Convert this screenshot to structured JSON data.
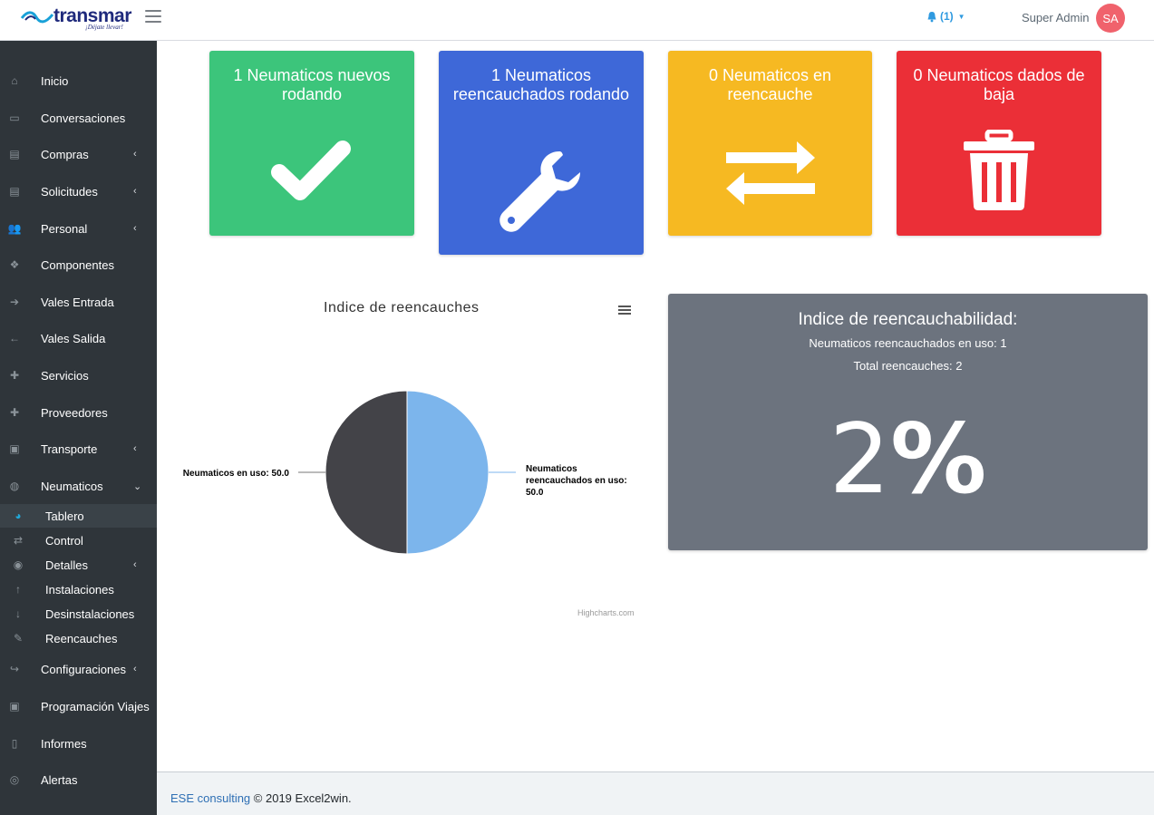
{
  "header": {
    "logo_text": "transmar",
    "logo_tagline": "¡Déjate llevar!",
    "notification_count": "(1)",
    "user_name": "Super Admin",
    "user_initials": "SA"
  },
  "sidebar": {
    "items": [
      {
        "label": "Inicio",
        "icon": "home-icon"
      },
      {
        "label": "Conversaciones",
        "icon": "chat-icon"
      },
      {
        "label": "Compras",
        "icon": "card-icon"
      },
      {
        "label": "Solicitudes",
        "icon": "card-icon"
      },
      {
        "label": "Personal",
        "icon": "users-icon"
      },
      {
        "label": "Componentes",
        "icon": "cubes-icon"
      },
      {
        "label": "Vales Entrada",
        "icon": "arrow-right-icon"
      },
      {
        "label": "Vales Salida",
        "icon": "arrow-left-icon"
      },
      {
        "label": "Servicios",
        "icon": "plus-icon"
      },
      {
        "label": "Proveedores",
        "icon": "plus-icon"
      },
      {
        "label": "Transporte",
        "icon": "bus-icon"
      },
      {
        "label": "Neumaticos",
        "icon": "globe-icon"
      }
    ],
    "sub_items": [
      {
        "label": "Tablero",
        "icon": "pie-icon"
      },
      {
        "label": "Control",
        "icon": "exchange-icon"
      },
      {
        "label": "Detalles",
        "icon": "eye-icon"
      },
      {
        "label": "Instalaciones",
        "icon": "arrow-up-icon"
      },
      {
        "label": "Desinstalaciones",
        "icon": "arrow-down-icon"
      },
      {
        "label": "Reencauches",
        "icon": "wrench-icon"
      }
    ],
    "items_bottom": [
      {
        "label": "Configuraciones",
        "icon": "share-icon"
      },
      {
        "label": "Programación Viajes",
        "icon": "bus-icon"
      },
      {
        "label": "Informes",
        "icon": "file-icon"
      },
      {
        "label": "Alertas",
        "icon": "alert-icon"
      }
    ]
  },
  "cards": [
    {
      "title": "1 Neumaticos nuevos rodando",
      "icon": "check-icon",
      "color": "#3cc57b"
    },
    {
      "title": "1 Neumaticos reencauchados rodando",
      "icon": "wrench-icon",
      "color": "#3e68d8"
    },
    {
      "title": "0 Neumaticos en reencauche",
      "icon": "exchange-icon",
      "color": "#f6b922"
    },
    {
      "title": "0 Neumaticos dados de baja",
      "icon": "trash-icon",
      "color": "#eb2f37"
    }
  ],
  "chart_data": {
    "type": "pie",
    "title": "Indice de reencauches",
    "series": [
      {
        "name": "Neumaticos reencauchados en uso",
        "value": 50.0,
        "label": "Neumaticos reencauchados en uso: 50.0",
        "color": "#7cb5ec"
      },
      {
        "name": "Neumaticos en uso",
        "value": 50.0,
        "label": "Neumaticos en uso: 50.0",
        "color": "#434348"
      }
    ],
    "credits": "Highcharts.com"
  },
  "index_panel": {
    "title": "Indice de reencauchabilidad:",
    "line1": "Neumaticos reencauchados en uso: 1",
    "line2": "Total reencauches: 2",
    "value_number": "2",
    "value_symbol": "%"
  },
  "footer": {
    "link": "ESE consulting",
    "text": "© 2019 Excel2win."
  }
}
